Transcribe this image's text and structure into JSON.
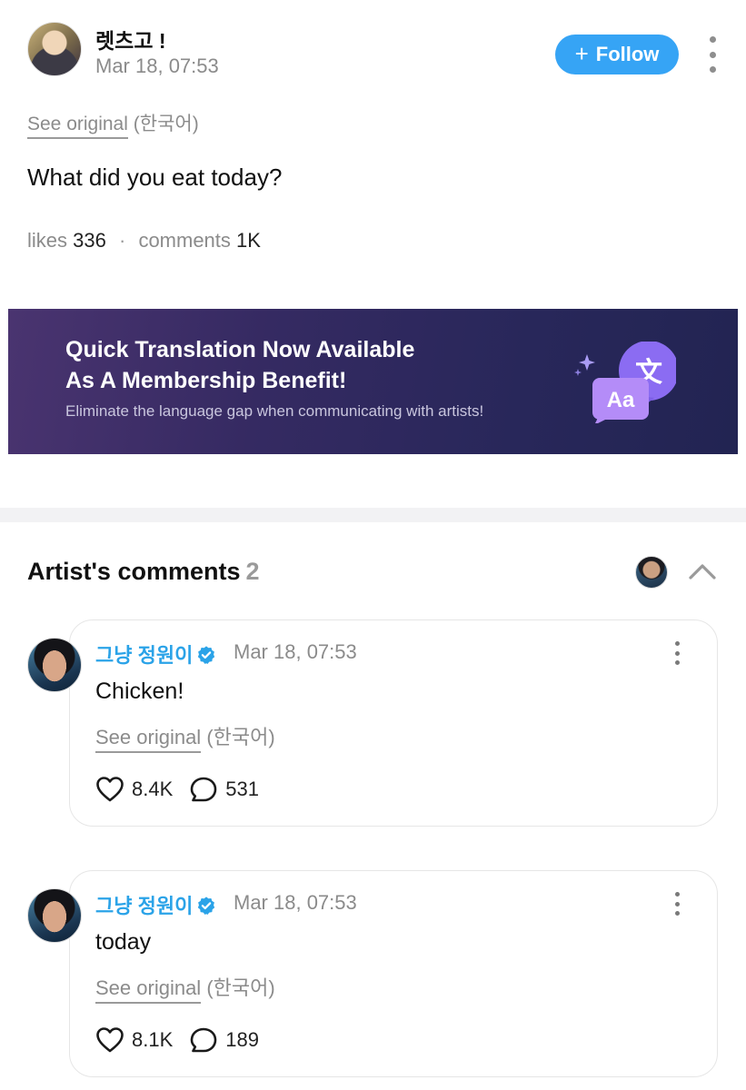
{
  "post": {
    "author_name": "렛츠고 !",
    "time": "Mar 18, 07:53",
    "follow_plus": "+",
    "follow_label": "Follow",
    "see_original": "See original",
    "original_lang": "(한국어)",
    "text": "What did you eat today?",
    "likes_label": "likes",
    "likes_count": "336",
    "separator": "·",
    "comments_label": "comments",
    "comments_count": "1K"
  },
  "banner": {
    "title_line1": "Quick Translation Now Available",
    "title_line2": "As A Membership Benefit!",
    "subtitle": "Eliminate the language gap when communicating with artists!",
    "icon_glyph_front": "Aa",
    "icon_glyph_back": "文"
  },
  "artist_comments": {
    "title": "Artist's comments",
    "count": "2",
    "items": [
      {
        "name": "그냥 정원이",
        "time": "Mar 18, 07:53",
        "text": "Chicken!",
        "see_original": "See original",
        "original_lang": "(한국어)",
        "likes": "8.4K",
        "replies": "531"
      },
      {
        "name": "그냥 정원이",
        "time": "Mar 18, 07:53",
        "text": "today",
        "see_original": "See original",
        "original_lang": "(한국어)",
        "likes": "8.1K",
        "replies": "189"
      }
    ]
  },
  "colors": {
    "accent_blue": "#36a4f5",
    "artist_name": "#2ba3e8",
    "verified": "#2ba3e8",
    "banner_bg": "#352a62",
    "muted_text": "#8b8b8b"
  },
  "icons": {
    "more": "more-vertical-icon",
    "verified": "verified-badge-icon",
    "like": "heart-icon",
    "reply": "comment-bubble-icon",
    "collapse": "chevron-up-icon",
    "translate": "translate-icon"
  }
}
